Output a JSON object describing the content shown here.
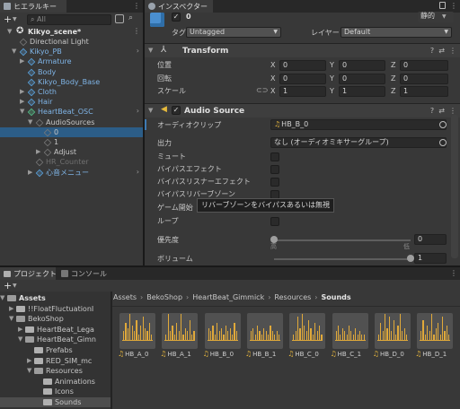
{
  "hierarchy": {
    "tab_label": "ヒエラルキー",
    "add_label": "+",
    "search_placeholder": "All",
    "scene_name": "Kikyo_scene*",
    "items": [
      {
        "label": "Directional Light",
        "indent": 2,
        "kind": "gray",
        "arrow": ""
      },
      {
        "label": "Kikyo_PB",
        "indent": 2,
        "kind": "blue",
        "arrow": "▼"
      },
      {
        "label": "Armature",
        "indent": 3,
        "kind": "blue",
        "arrow": "▶"
      },
      {
        "label": "Body",
        "indent": 3,
        "kind": "blue",
        "arrow": ""
      },
      {
        "label": "Kikyo_Body_Base",
        "indent": 3,
        "kind": "blue",
        "arrow": ""
      },
      {
        "label": "Cloth",
        "indent": 3,
        "kind": "blue",
        "arrow": "▶"
      },
      {
        "label": "Hair",
        "indent": 3,
        "kind": "blue",
        "arrow": "▶"
      },
      {
        "label": "HeartBeat_OSC",
        "indent": 3,
        "kind": "green",
        "arrow": "▼"
      },
      {
        "label": "AudioSources",
        "indent": 4,
        "kind": "gray",
        "arrow": "▼"
      },
      {
        "label": "0",
        "indent": 5,
        "kind": "gray",
        "arrow": ""
      },
      {
        "label": "1",
        "indent": 5,
        "kind": "gray",
        "arrow": ""
      },
      {
        "label": "Adjust",
        "indent": 5,
        "kind": "gray",
        "arrow": "▶"
      },
      {
        "label": "HR_Counter",
        "indent": 4,
        "kind": "gray",
        "arrow": ""
      },
      {
        "label": "心音メニュー",
        "indent": 4,
        "kind": "blue",
        "arrow": "▶"
      }
    ]
  },
  "inspector": {
    "tab_label": "インスペクター",
    "object_name": "0",
    "static_label": "静的",
    "tag_label": "タグ",
    "tag_value": "Untagged",
    "layer_label": "レイヤー",
    "layer_value": "Default",
    "transform": {
      "title": "Transform",
      "rows": [
        {
          "label": "位置",
          "x": "0",
          "y": "0",
          "z": "0"
        },
        {
          "label": "回転",
          "x": "0",
          "y": "0",
          "z": "0"
        },
        {
          "label": "スケール",
          "x": "1",
          "y": "1",
          "z": "1"
        }
      ],
      "axis_x": "X",
      "axis_y": "Y",
      "axis_z": "Z"
    },
    "audio": {
      "title": "Audio Source",
      "clip_label": "オーディオクリップ",
      "clip_value": "HB_B_0",
      "output_label": "出力",
      "output_value": "なし (オーディオミキサーグループ)",
      "mute_label": "ミュート",
      "bypass_effects_label": "バイパスエフェクト",
      "bypass_listener_label": "バイパスリスナーエフェクト",
      "bypass_reverb_label": "バイパスリバーブゾーン",
      "game_label": "ゲーム開始",
      "tooltip": "リバーブゾーンをバイパスあるいは無視",
      "loop_label": "ループ",
      "priority_label": "優先度",
      "priority_value": "0",
      "priority_fraction": 0.0,
      "priority_low": "高",
      "priority_high": "低",
      "volume_label": "ボリューム",
      "volume_value": "1",
      "volume_fraction": 1.0
    }
  },
  "project": {
    "tab_project": "プロジェクト",
    "tab_console": "コンソール",
    "add_label": "+",
    "breadcrumb": [
      "Assets",
      "BekoShop",
      "HeartBeat_Gimmick",
      "Resources",
      "Sounds"
    ],
    "tree": [
      {
        "label": "Assets",
        "indent": 0,
        "arrow": "▼",
        "bold": true
      },
      {
        "label": "!!FloatFluctuationI",
        "indent": 1,
        "arrow": "▶",
        "bold": false
      },
      {
        "label": "BekoShop",
        "indent": 1,
        "arrow": "▼",
        "bold": false
      },
      {
        "label": "HeartBeat_Lega",
        "indent": 2,
        "arrow": "▶",
        "bold": false
      },
      {
        "label": "HeartBeat_Gimn",
        "indent": 2,
        "arrow": "▼",
        "bold": false
      },
      {
        "label": "Prefabs",
        "indent": 3,
        "arrow": "",
        "bold": false
      },
      {
        "label": "RED_SIM_mc",
        "indent": 3,
        "arrow": "▶",
        "bold": false
      },
      {
        "label": "Resources",
        "indent": 3,
        "arrow": "▼",
        "bold": false
      },
      {
        "label": "Animations",
        "indent": 4,
        "arrow": "",
        "bold": false
      },
      {
        "label": "Icons",
        "indent": 4,
        "arrow": "",
        "bold": false
      },
      {
        "label": "Sounds",
        "indent": 4,
        "arrow": "",
        "bold": false
      }
    ],
    "assets": [
      "HB_A_0",
      "HB_A_1",
      "HB_B_0",
      "HB_B_1",
      "HB_C_0",
      "HB_C_1",
      "HB_D_0",
      "HB_D_1"
    ]
  }
}
